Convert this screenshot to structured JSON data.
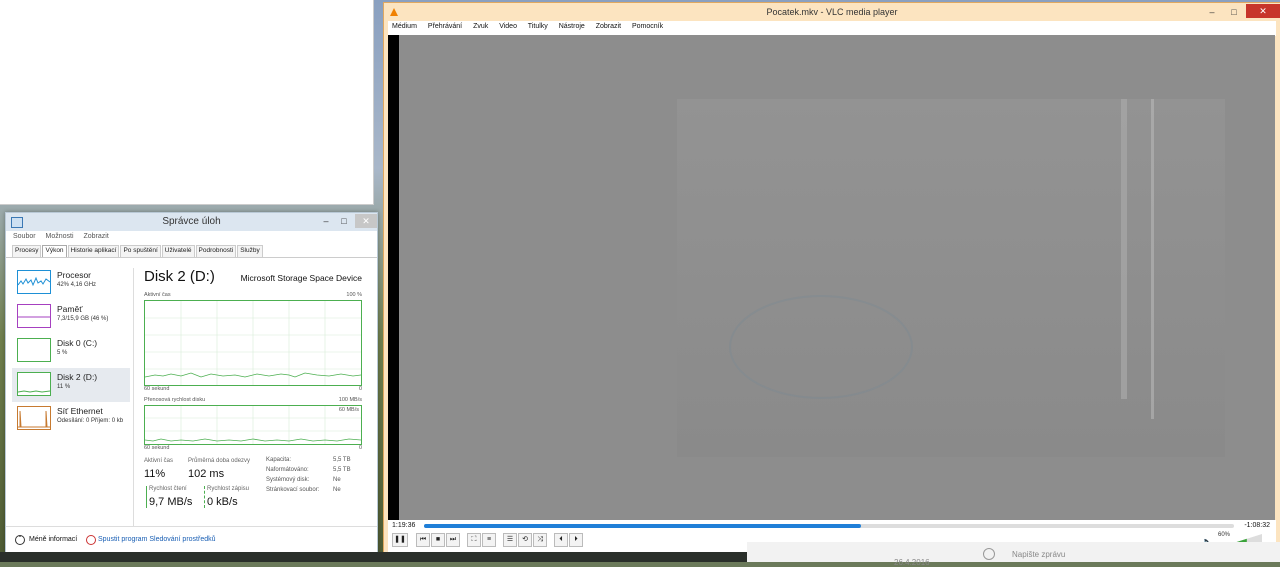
{
  "task_manager": {
    "title": "Správce úloh",
    "menu": [
      "Soubor",
      "Možnosti",
      "Zobrazit"
    ],
    "tabs": [
      "Procesy",
      "Výkon",
      "Historie aplikací",
      "Po spuštění",
      "Uživatelé",
      "Podrobnosti",
      "Služby"
    ],
    "active_tab": "Výkon",
    "sidebar": [
      {
        "name": "Procesor",
        "sub": "42% 4,16 GHz",
        "color": "#1e90d6"
      },
      {
        "name": "Paměť",
        "sub": "7,3/15,9 GB (46 %)",
        "color": "#a640c0"
      },
      {
        "name": "Disk 0 (C:)",
        "sub": "5 %",
        "color": "#4caf50"
      },
      {
        "name": "Disk 2 (D:)",
        "sub": "11 %",
        "color": "#4caf50"
      },
      {
        "name": "Síť Ethernet",
        "sub": "Odesílání: 0 Příjem: 0 kb",
        "color": "#c77a30"
      }
    ],
    "selected_item": "Disk 2 (D:)",
    "detail": {
      "title": "Disk 2 (D:)",
      "model": "Microsoft Storage Space Device",
      "graph1_label": "Aktivní čas",
      "graph1_max": "100 %",
      "graph1_xlabel": "60 sekund",
      "graph1_min": "0",
      "graph2_label": "Přenosová rychlost disku",
      "graph2_max": "100 MB/s",
      "graph2_mark": "60 MB/s",
      "graph2_xlabel": "60 sekund",
      "graph2_min": "0",
      "active_time_label": "Aktivní čas",
      "active_time_value": "11%",
      "resp_label": "Průměrná doba odezvy",
      "resp_value": "102 ms",
      "read_label": "Rychlost čtení",
      "read_value": "9,7 MB/s",
      "write_label": "Rychlost zápisu",
      "write_value": "0 kB/s",
      "kv": [
        {
          "k": "Kapacita:",
          "v": "5,5 TB"
        },
        {
          "k": "Naformátováno:",
          "v": "5,5 TB"
        },
        {
          "k": "Systémový disk:",
          "v": "Ne"
        },
        {
          "k": "Stránkovací soubor:",
          "v": "Ne"
        }
      ]
    },
    "footer": {
      "less_label": "Méně informací",
      "monitor_label": "Spustit program Sledování prostředků"
    }
  },
  "vlc": {
    "title": "Pocatek.mkv - VLC media player",
    "menu": [
      "Médium",
      "Přehrávání",
      "Zvuk",
      "Video",
      "Titulky",
      "Nástroje",
      "Zobrazit",
      "Pomocník"
    ],
    "time_elapsed": "1:19:36",
    "time_remaining": "-1:08:32",
    "progress_fraction": 0.54,
    "volume": "60%",
    "accent": "#1f7fd8"
  },
  "taskbar": {
    "snippet_text": "Napište zprávu",
    "date_text": "26.4.2016"
  }
}
